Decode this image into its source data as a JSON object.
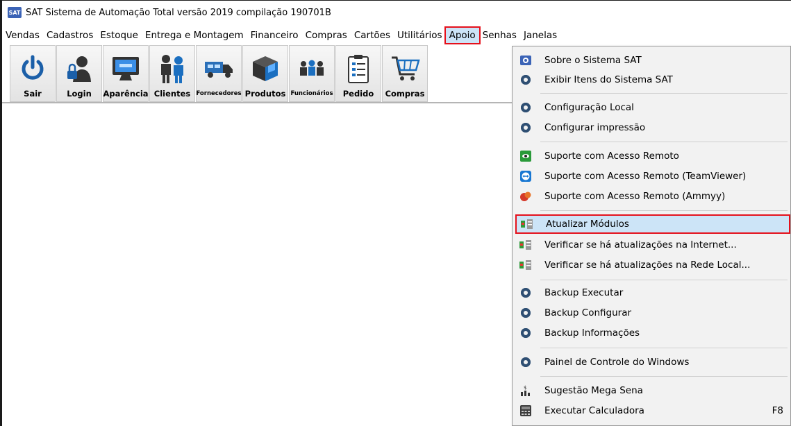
{
  "window": {
    "title": "SAT Sistema de Automação Total versão 2019 compilação 190701B",
    "app_icon_text": "SAT"
  },
  "menubar": [
    "Vendas",
    "Cadastros",
    "Estoque",
    "Entrega e Montagem",
    "Financeiro",
    "Compras",
    "Cartões",
    "Utilitários",
    "Apoio",
    "Senhas",
    "Janelas"
  ],
  "toolbar": [
    {
      "label": "Sair",
      "icon": "power-icon"
    },
    {
      "label": "Login",
      "icon": "user-lock-icon"
    },
    {
      "label": "Aparência",
      "icon": "monitor-icon"
    },
    {
      "label": "Clientes",
      "icon": "people-icon"
    },
    {
      "label": "Fornecedores",
      "icon": "truck-icon"
    },
    {
      "label": "Produtos",
      "icon": "boxes-icon"
    },
    {
      "label": "Funcionários",
      "icon": "team-icon"
    },
    {
      "label": "Pedido",
      "icon": "clipboard-icon"
    },
    {
      "label": "Compras",
      "icon": "cart-icon"
    }
  ],
  "dropdown": {
    "items": [
      {
        "label": "Sobre o Sistema SAT",
        "icon": "sat-logo-icon",
        "shortcut": ""
      },
      {
        "label": "Exibir Itens do Sistema SAT",
        "icon": "gear-icon",
        "shortcut": ""
      },
      {
        "label": "Configuração Local",
        "icon": "gear-icon",
        "shortcut": ""
      },
      {
        "label": "Configurar impressão",
        "icon": "gear-icon",
        "shortcut": ""
      },
      {
        "label": "Suporte com Acesso Remoto",
        "icon": "remote-green-icon",
        "shortcut": ""
      },
      {
        "label": "Suporte com Acesso Remoto (TeamViewer)",
        "icon": "teamviewer-icon",
        "shortcut": ""
      },
      {
        "label": "Suporte com Acesso Remoto (Ammyy)",
        "icon": "ammyy-icon",
        "shortcut": ""
      },
      {
        "label": "Atualizar Módulos",
        "icon": "update-modules-icon",
        "shortcut": ""
      },
      {
        "label": "Verificar se há atualizações na Internet...",
        "icon": "update-modules-icon",
        "shortcut": ""
      },
      {
        "label": "Verificar se há atualizações na Rede Local...",
        "icon": "update-modules-icon",
        "shortcut": ""
      },
      {
        "label": "Backup Executar",
        "icon": "gear-icon",
        "shortcut": ""
      },
      {
        "label": "Backup Configurar",
        "icon": "gear-icon",
        "shortcut": ""
      },
      {
        "label": "Backup Informações",
        "icon": "gear-icon",
        "shortcut": ""
      },
      {
        "label": "Painel de Controle do Windows",
        "icon": "gear-icon",
        "shortcut": ""
      },
      {
        "label": "Sugestão Mega Sena",
        "icon": "chart-dollar-icon",
        "shortcut": ""
      },
      {
        "label": "Executar Calculadora",
        "icon": "calculator-icon",
        "shortcut": "F8"
      }
    ]
  },
  "colors": {
    "highlight": "#cce4f7",
    "annotation_red": "#e5101b"
  }
}
